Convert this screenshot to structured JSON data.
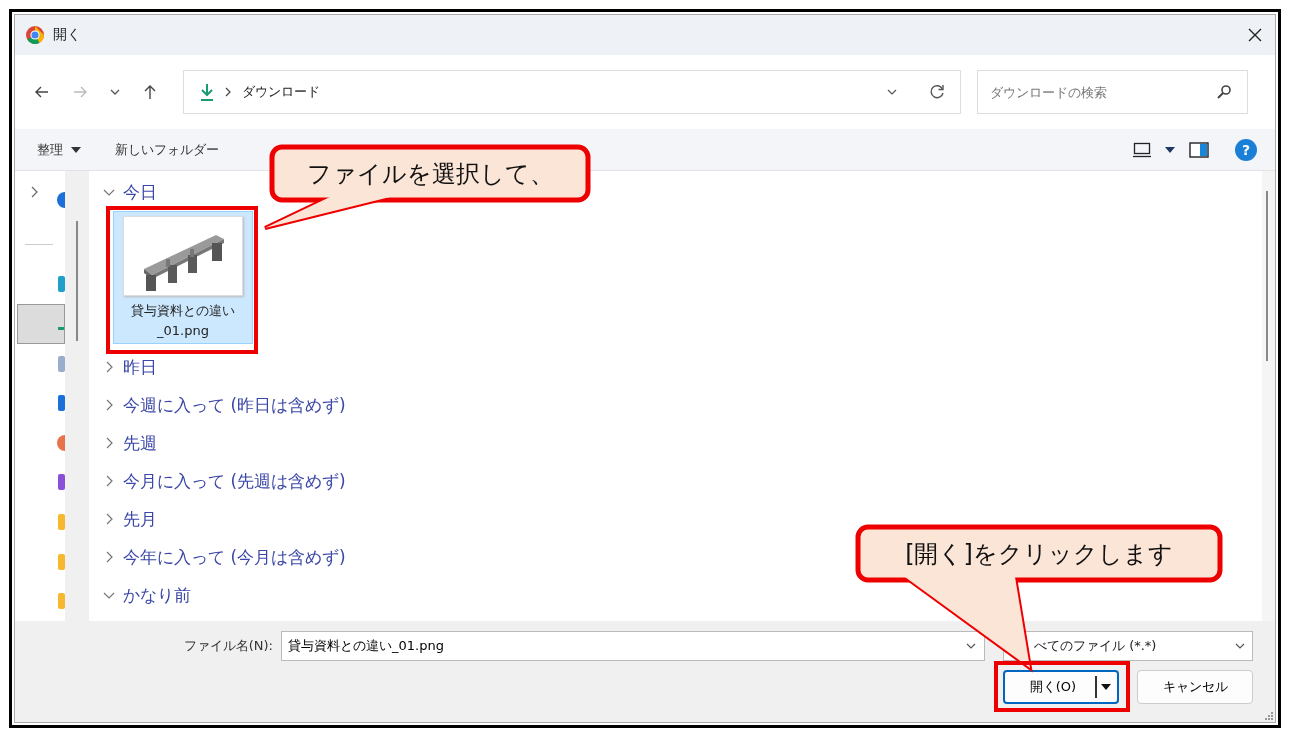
{
  "window": {
    "title": "開く"
  },
  "navigation": {
    "back_enabled": true,
    "forward_enabled": false
  },
  "address": {
    "path": "ダウンロード"
  },
  "search": {
    "placeholder": "ダウンロードの検索"
  },
  "toolbar": {
    "organize": "整理",
    "new_folder": "新しいフォルダー",
    "help": "?"
  },
  "nav_items": [
    {
      "kind": "cloud",
      "selected": false
    },
    {
      "kind": "app",
      "selected": false
    },
    {
      "kind": "download",
      "selected": true
    },
    {
      "kind": "document",
      "selected": false
    },
    {
      "kind": "blue",
      "selected": false
    },
    {
      "kind": "music",
      "selected": false
    },
    {
      "kind": "video",
      "selected": false
    },
    {
      "kind": "folder",
      "selected": false
    },
    {
      "kind": "folder",
      "selected": false
    },
    {
      "kind": "folder",
      "selected": false
    }
  ],
  "groups": [
    {
      "label": "今日",
      "expanded": true,
      "files": [
        {
          "name": "貸与資料との違い_01.png",
          "selected": true
        }
      ]
    },
    {
      "label": "昨日",
      "expanded": false
    },
    {
      "label": "今週に入って (昨日は含めず)",
      "expanded": false
    },
    {
      "label": "先週",
      "expanded": false
    },
    {
      "label": "今月に入って (先週は含めず)",
      "expanded": false
    },
    {
      "label": "先月",
      "expanded": false
    },
    {
      "label": "今年に入って (今月は含めず)",
      "expanded": false
    },
    {
      "label": "かなり前",
      "expanded": true
    }
  ],
  "file_name": {
    "label": "ファイル名(N):",
    "value": "貸与資料との違い_01.png"
  },
  "file_type": {
    "value": "べてのファイル (*.*)"
  },
  "buttons": [
    {
      "label": "開く(O)",
      "kind": "split"
    },
    {
      "label": "キャンセル",
      "kind": "plain"
    }
  ],
  "annotations": [
    {
      "text": "ファイルを選択して、"
    },
    {
      "text": "[開く]をクリックします"
    }
  ]
}
